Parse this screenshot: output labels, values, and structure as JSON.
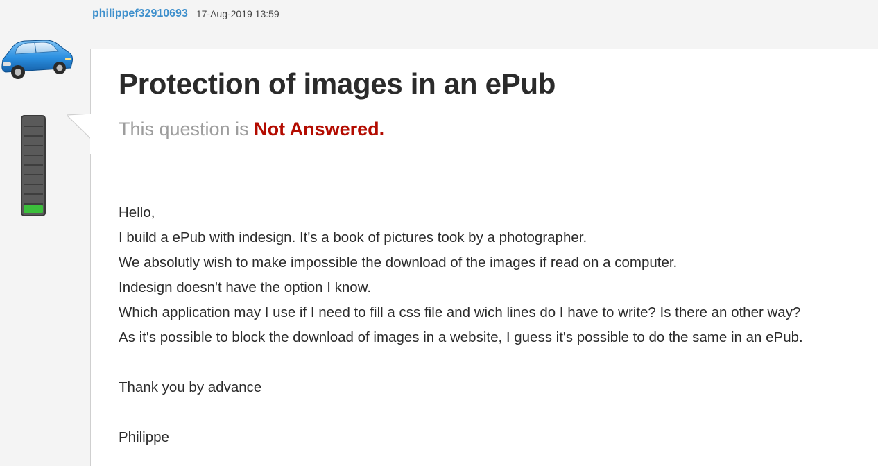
{
  "post": {
    "author": "philippef32910693",
    "timestamp": "17-Aug-2019 13:59",
    "avatar_icon": "blue-car-icon",
    "rank_icon": "status-meter-icon"
  },
  "question": {
    "title": "Protection of images in an ePub",
    "status_prefix": "This question is",
    "status_value": "Not Answered.",
    "status_color": "#b30b00"
  },
  "body": {
    "lines": [
      "Hello,",
      "I build a ePub with indesign. It's a book of pictures took by a photographer.",
      "We absolutly wish to make impossible the download of the images if read on a computer.",
      "Indesign doesn't have the option I know.",
      "Which application may I use if I need to fill a css file and wich lines do I have to write? Is there an other way?",
      "As it's possible to block the download of images in a website, I guess it's possible to do the same in an ePub."
    ],
    "closing": "Thank you by advance",
    "signature": "Philippe"
  },
  "colors": {
    "username": "#3d8fcc",
    "meter_fill": "#3cbf3c",
    "meter_body": "#555555"
  },
  "rank_level": 0.1
}
